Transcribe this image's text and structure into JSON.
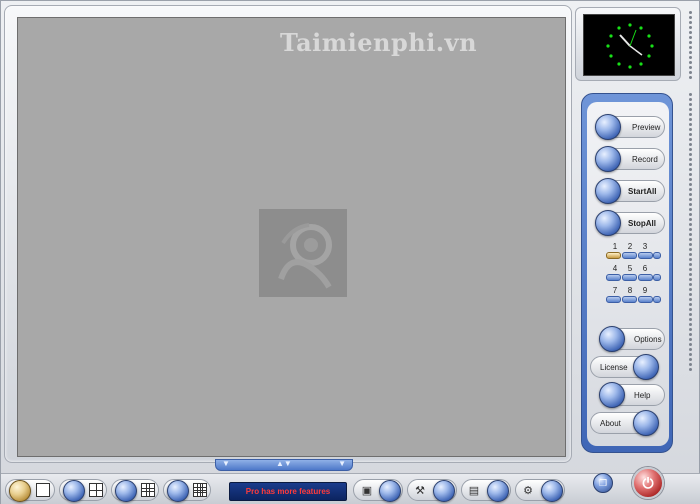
{
  "watermark": "Taimienphi.vn",
  "controls": {
    "preview": "Preview",
    "record": "Record",
    "start_all": "StartAll",
    "stop_all": "StopAll",
    "options": "Options",
    "license": "License",
    "help": "Help",
    "about": "About"
  },
  "channel_grid": {
    "numbers": [
      "1",
      "2",
      "3",
      "4",
      "5",
      "6",
      "7",
      "8",
      "9"
    ],
    "active_channel": "1"
  },
  "bottom_bar": {
    "promo_text": "Pro has more features"
  },
  "icons": {
    "clock": "analog-clock-icon",
    "power": "power-icon",
    "restore": "restore-window-icon",
    "tool_1": "monitor-icon",
    "tool_2": "tools-icon",
    "tool_3": "window-icon",
    "tool_4": "settings-icon"
  },
  "colors": {
    "accent": "#3f65b5",
    "clock_marks": "#18e018",
    "promo_text": "#ff3b3b",
    "power": "#a82020"
  }
}
